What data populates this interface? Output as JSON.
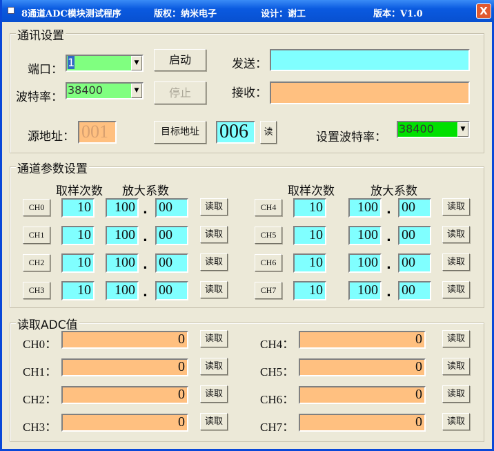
{
  "titlebar": {
    "app": "8通道ADC模块测试程序",
    "copyright": "版权：纳米电子",
    "design": "设计：谢工",
    "version": "版本：V1.0",
    "close": "X"
  },
  "comm": {
    "legend": "通讯设置",
    "port_label": "端口：",
    "port_value": "1",
    "baud_label": "波特率：",
    "baud_value": "38400",
    "start": "启动",
    "stop": "停止",
    "send_label": "发送：",
    "send_value": "",
    "recv_label": "接收：",
    "recv_value": "",
    "src_label": "源地址：",
    "src_value": "001",
    "target_btn": "目标地址",
    "target_value": "006",
    "read_btn": "读",
    "set_baud_label": "设置波特率：",
    "set_baud_value": "38400"
  },
  "params": {
    "legend": "通道参数设置",
    "h_samples": "取样次数",
    "h_gain": "放大系数",
    "dot": ".",
    "read": "读取",
    "channels": [
      {
        "name": "CH0",
        "samples": "10",
        "gain_int": "100",
        "gain_frac": "00"
      },
      {
        "name": "CH1",
        "samples": "10",
        "gain_int": "100",
        "gain_frac": "00"
      },
      {
        "name": "CH2",
        "samples": "10",
        "gain_int": "100",
        "gain_frac": "00"
      },
      {
        "name": "CH3",
        "samples": "10",
        "gain_int": "100",
        "gain_frac": "00"
      },
      {
        "name": "CH4",
        "samples": "10",
        "gain_int": "100",
        "gain_frac": "00"
      },
      {
        "name": "CH5",
        "samples": "10",
        "gain_int": "100",
        "gain_frac": "00"
      },
      {
        "name": "CH6",
        "samples": "10",
        "gain_int": "100",
        "gain_frac": "00"
      },
      {
        "name": "CH7",
        "samples": "10",
        "gain_int": "100",
        "gain_frac": "00"
      }
    ]
  },
  "adc": {
    "legend": "读取ADC值",
    "read": "读取",
    "channels": [
      {
        "label": "CH0：",
        "value": "0"
      },
      {
        "label": "CH1：",
        "value": "0"
      },
      {
        "label": "CH2：",
        "value": "0"
      },
      {
        "label": "CH3：",
        "value": "0"
      },
      {
        "label": "CH4：",
        "value": "0"
      },
      {
        "label": "CH5：",
        "value": "0"
      },
      {
        "label": "CH6：",
        "value": "0"
      },
      {
        "label": "CH7：",
        "value": "0"
      }
    ]
  }
}
